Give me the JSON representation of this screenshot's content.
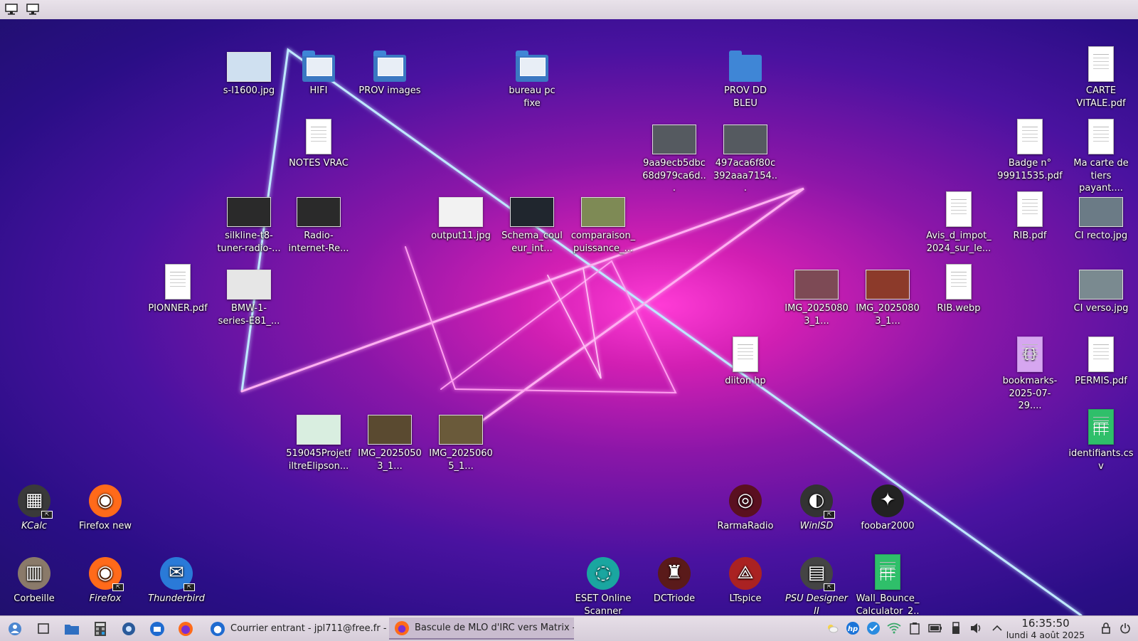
{
  "topbar": {
    "left_icons": [
      "monitor-icon",
      "monitor-icon"
    ]
  },
  "desktop_icons": [
    {
      "label": "s-l1600.jpg",
      "kind": "thumb",
      "col": "#cfe0f0"
    },
    {
      "label": "HIFI",
      "kind": "folder-img"
    },
    {
      "label": "PROV images",
      "kind": "folder-img"
    },
    {
      "label": "bureau pc fixe",
      "kind": "folder-img"
    },
    {
      "label": "PROV DD BLEU",
      "kind": "folder"
    },
    {
      "label": "CARTE VITALE.pdf",
      "kind": "doc"
    },
    {
      "label": "NOTES VRAC",
      "kind": "doc"
    },
    {
      "label": "9aa9ecb5dbc68d979ca6d...",
      "kind": "thumb",
      "col": "#555a60"
    },
    {
      "label": "497aca6f80c392aaa7154...",
      "kind": "thumb",
      "col": "#555a60"
    },
    {
      "label": "Badge n° 99911535.pdf",
      "kind": "doc"
    },
    {
      "label": "Ma carte de tiers payant....",
      "kind": "doc"
    },
    {
      "label": "silkline-t8-tuner-radio-...",
      "kind": "thumb",
      "col": "#2a2a2a"
    },
    {
      "label": "Radio-internet-Re...",
      "kind": "thumb",
      "col": "#2a2a2a"
    },
    {
      "label": "output11.jpg",
      "kind": "thumb",
      "col": "#f2f2f2"
    },
    {
      "label": "Schema_couleur_int...",
      "kind": "thumb",
      "col": "#20262e"
    },
    {
      "label": "comparaison_puissance_...",
      "kind": "thumb",
      "col": "#7e8a55"
    },
    {
      "label": "Avis_d_impot_2024_sur_le...",
      "kind": "doc"
    },
    {
      "label": "RIB.pdf",
      "kind": "doc"
    },
    {
      "label": "CI recto.jpg",
      "kind": "thumb",
      "col": "#6b7b86"
    },
    {
      "label": "PIONNER.pdf",
      "kind": "doc"
    },
    {
      "label": "BMW-1-series-E81_...",
      "kind": "thumb",
      "col": "#e6e6e6"
    },
    {
      "label": "IMG_20250803_1...",
      "kind": "thumb",
      "col": "#7d4a55"
    },
    {
      "label": "IMG_20250803_1...",
      "kind": "thumb",
      "col": "#8c3a2a"
    },
    {
      "label": "RIB.webp",
      "kind": "doc"
    },
    {
      "label": "CI verso.jpg",
      "kind": "thumb",
      "col": "#7a8a90"
    },
    {
      "label": "diiton hp",
      "kind": "doc"
    },
    {
      "label": "bookmarks-2025-07-29....",
      "kind": "json"
    },
    {
      "label": "PERMIS.pdf",
      "kind": "doc"
    },
    {
      "label": "519045ProjetfiltreElipson...",
      "kind": "thumb",
      "col": "#d9eee0"
    },
    {
      "label": "IMG_20250503_1...",
      "kind": "thumb",
      "col": "#5a4a30"
    },
    {
      "label": "IMG_20250605_1...",
      "kind": "thumb",
      "col": "#6a5a3a"
    },
    {
      "label": "identifiants.csv",
      "kind": "sheet"
    },
    {
      "label": "KCalc",
      "kind": "app",
      "italic": true,
      "glyph": "▦",
      "bg": "#3a3a3a",
      "emblem": true
    },
    {
      "label": "Firefox new",
      "kind": "app",
      "glyph": "◉",
      "bg": "#ff6a1a"
    },
    {
      "label": "RarmaRadio",
      "kind": "app",
      "glyph": "◎",
      "bg": "#5a1020"
    },
    {
      "label": "WinISD",
      "kind": "app",
      "italic": true,
      "glyph": "◐",
      "bg": "#333",
      "emblem": true
    },
    {
      "label": "foobar2000",
      "kind": "app",
      "glyph": "✦",
      "bg": "#222"
    },
    {
      "label": "Corbeille",
      "kind": "app",
      "glyph": "▥",
      "bg": "#8a7a6a"
    },
    {
      "label": "Firefox",
      "kind": "app",
      "italic": true,
      "glyph": "◉",
      "bg": "#ff6a1a",
      "emblem": true
    },
    {
      "label": "Thunderbird",
      "kind": "app",
      "italic": true,
      "glyph": "✉",
      "bg": "#2a7ad8",
      "emblem": true
    },
    {
      "label": "ESET Online Scanner",
      "kind": "app",
      "glyph": "◌",
      "bg": "#1aa6a0"
    },
    {
      "label": "DCTriode",
      "kind": "app",
      "glyph": "♜",
      "bg": "#5a1a1a"
    },
    {
      "label": "LTspice",
      "kind": "app",
      "glyph": "⟁",
      "bg": "#aa2222"
    },
    {
      "label": "PSU Designer II",
      "kind": "app",
      "italic": true,
      "glyph": "▤",
      "bg": "#444",
      "emblem": true
    },
    {
      "label": "Wall_Bounce_Calculator_2...",
      "kind": "sheet"
    }
  ],
  "taskbar": {
    "launchers": [
      "application-menu-icon",
      "show-desktop-icon",
      "file-manager-icon",
      "calculator-icon",
      "settings-icon",
      "thunderbird-icon",
      "firefox-icon"
    ],
    "tasks": [
      {
        "label": "Courrier entrant - jpl711@free.fr - ...",
        "icon": "thunderbird-icon",
        "active": false
      },
      {
        "label": "Bascule de MLO d'IRC vers Matrix -...",
        "icon": "firefox-icon",
        "active": true
      }
    ],
    "tray": [
      "weather-icon",
      "hp-icon",
      "check-icon",
      "wifi-icon",
      "clipboard-icon",
      "battery-icon",
      "usb-icon",
      "volume-icon",
      "expand-tray-icon"
    ],
    "clock": {
      "time": "16:35:50",
      "date": "lundi 4 août 2025"
    },
    "right": [
      "lock-icon",
      "power-icon"
    ]
  }
}
